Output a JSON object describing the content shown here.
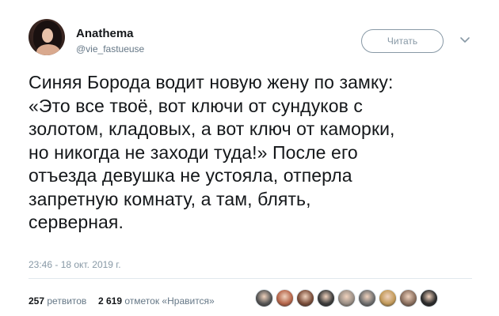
{
  "tweet": {
    "display_name": "Anathema",
    "handle": "@vie_fastueuse",
    "follow_label": "Читать",
    "text_lines": [
      "Синяя Борода водит новую жену по замку:",
      "«Это все твоё, вот ключи от сундуков с",
      "золотом, кладовых, а вот ключ от каморки,",
      "но никогда не заходи туда!» После его",
      "отъезда девушка не устояла, отперла",
      "запретную комнату, а там, блять,",
      "серверная."
    ],
    "timestamp": "23:46 - 18 окт. 2019 г.",
    "retweets_count": "257",
    "retweets_label": "ретвитов",
    "likes_count": "2 619",
    "likes_label": "отметок «Нравится»",
    "liker_avatar_colors": [
      "#555555",
      "#b5654a",
      "#7a4d3a",
      "#3c3c3c",
      "#9a8f86",
      "#6f6f6f",
      "#c29a5a",
      "#8a6f5e",
      "#2b2b2b"
    ]
  }
}
